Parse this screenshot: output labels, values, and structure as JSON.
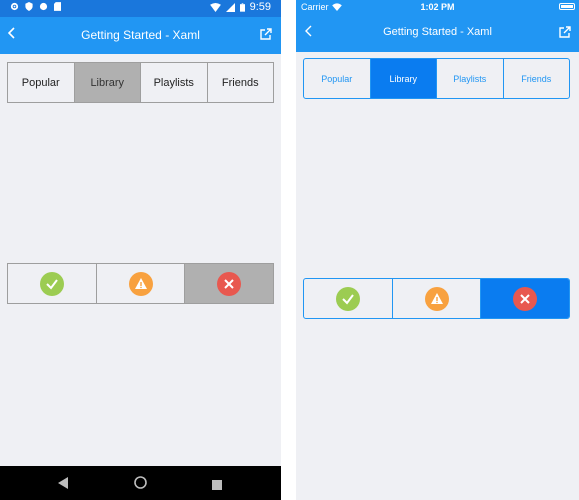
{
  "android": {
    "status_bar": {
      "time": "9:59"
    },
    "app_bar": {
      "title": "Getting Started - Xaml"
    },
    "segment_tabs": [
      "Popular",
      "Library",
      "Playlists",
      "Friends"
    ],
    "tabs_selected": "Library",
    "status_segments": [
      "check",
      "warning",
      "error"
    ],
    "status_selected": "error",
    "nav_buttons": [
      "back",
      "home",
      "recents"
    ]
  },
  "ios": {
    "status_bar": {
      "carrier": "Carrier",
      "time": "1:02 PM"
    },
    "app_bar": {
      "title": "Getting Started - Xaml"
    },
    "segment_tabs": [
      "Popular",
      "Library",
      "Playlists",
      "Friends"
    ],
    "tabs_selected": "Library",
    "status_segments": [
      "check",
      "warning",
      "error"
    ],
    "status_selected": "error"
  },
  "colors": {
    "app_bar": "#2196f3",
    "android_status_bar": "#1a77dc",
    "android_selected_segment": "#b0b0b0",
    "ios_selected_segment": "#0a7cf0",
    "background": "#eff0f4",
    "check_green": "#9ccc52",
    "warning_orange": "#f8a13f",
    "error_red": "#e8584f"
  }
}
